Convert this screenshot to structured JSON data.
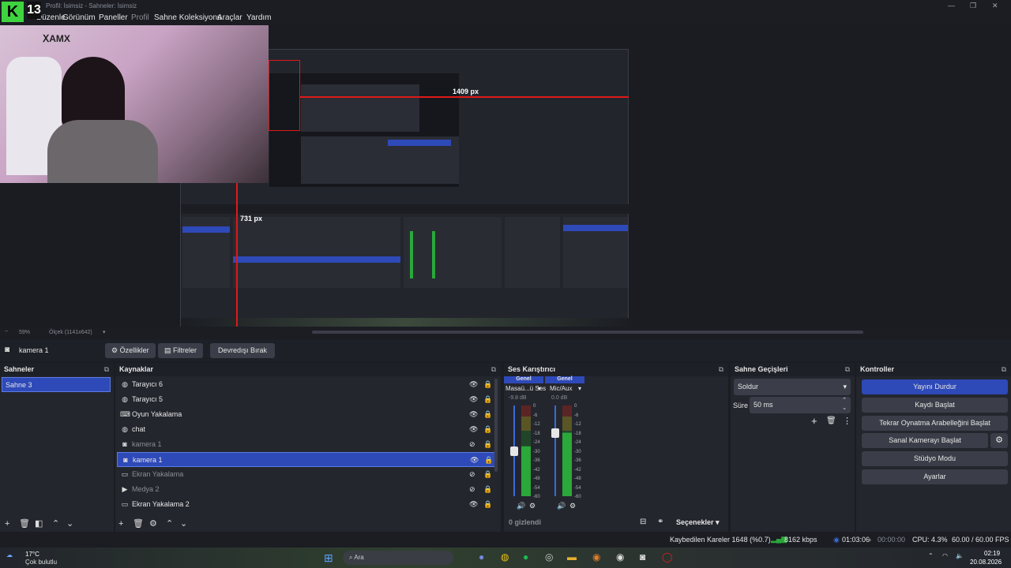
{
  "window": {
    "title": "Profil: İsimsiz - Sahneler: İsimsiz"
  },
  "menu": [
    "Düzenle",
    "Görünüm",
    "Paneller",
    "Profil",
    "Sahne Koleksiyonu",
    "Araçlar",
    "Yardım"
  ],
  "preview": {
    "measure_h": "1409 px",
    "measure_v": "731 px",
    "zoom": "59%",
    "zoom_label": "Ölçek (1141x642)"
  },
  "source_toolbar": {
    "selected": "kamera 1",
    "properties": "Özellikler",
    "filters": "Filtreler",
    "deactivate": "Devredışı Bırak"
  },
  "scenes": {
    "title": "Sahneler",
    "items": [
      "Sahne 3"
    ]
  },
  "sources": {
    "title": "Kaynaklar",
    "items": [
      {
        "label": "Tarayıcı 6",
        "icon": "globe-icon",
        "visible": true
      },
      {
        "label": "Tarayıcı 5",
        "icon": "globe-icon",
        "visible": true
      },
      {
        "label": "Oyun Yakalama",
        "icon": "gamepad-icon",
        "visible": true
      },
      {
        "label": "chat",
        "icon": "globe-icon",
        "visible": true
      },
      {
        "label": "kamera 1",
        "icon": "camera-icon",
        "visible": false
      },
      {
        "label": "kamera 1",
        "icon": "camera-icon",
        "visible": true,
        "selected": true
      },
      {
        "label": "Ekran Yakalama",
        "icon": "monitor-icon",
        "visible": false
      },
      {
        "label": "Medya 2",
        "icon": "play-icon",
        "visible": false
      },
      {
        "label": "Ekran Yakalama 2",
        "icon": "monitor-icon",
        "visible": true
      }
    ]
  },
  "mixer": {
    "title": "Ses Karıştırıcı",
    "channels": [
      {
        "tag": "Genel",
        "name": "Masaü...ü Ses",
        "db": "-9.8 dB",
        "level": 0.55
      },
      {
        "tag": "Genel",
        "name": "Mic/Aux",
        "db": "0.0 dB",
        "level": 0.75
      }
    ],
    "scale": [
      "0",
      "-6",
      "-12",
      "-18",
      "-24",
      "-30",
      "-36",
      "-42",
      "-48",
      "-54",
      "-60"
    ],
    "hidden": "0 gizlendi",
    "options": "Seçenekler"
  },
  "transitions": {
    "title": "Sahne Geçişleri",
    "type": "Soldur",
    "duration_label": "Süre",
    "duration": "50 ms"
  },
  "controls": {
    "title": "Kontroller",
    "buttons": [
      "Yayını Durdur",
      "Kaydı Başlat",
      "Tekrar Oynatma Arabelleğini Başlat",
      "Sanal Kamerayı Başlat",
      "Stüdyo Modu",
      "Ayarlar"
    ]
  },
  "status": {
    "dropped": "Kaybedilen Kareler 1648 (%0.7)",
    "bitrate": "8162 kbps",
    "stream_time": "01:03:06",
    "rec_time": "00:00:00",
    "cpu": "CPU: 4.3%",
    "fps": "60.00 / 60.00 FPS"
  },
  "taskbar": {
    "temp": "17°C",
    "weather": "Çok bulutlu",
    "search": "Ara",
    "time": "02:19",
    "date": "20.08.2026"
  },
  "colors": {
    "accent": "#2e49b8",
    "panel": "#24262e",
    "measure": "#e01818"
  }
}
